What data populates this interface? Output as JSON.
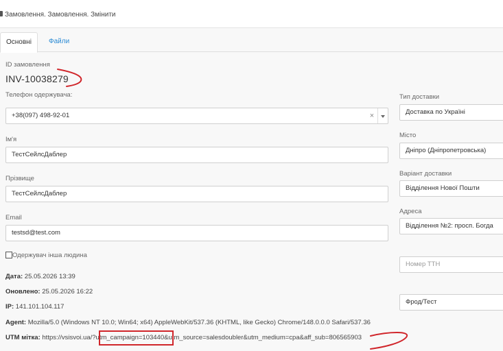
{
  "header": {
    "title": "Замовлення. Замовлення. Змінити"
  },
  "tabs": [
    {
      "label": "Основні"
    },
    {
      "label": "Файли"
    }
  ],
  "order": {
    "id_label": "ID замовлення",
    "id_value": "INV-10038279"
  },
  "form": {
    "phone": {
      "label": "Телефон одержувача:",
      "value": "+38(097) 498-92-01",
      "clear": "×"
    },
    "first_name": {
      "label": "Ім'я",
      "value": "ТестСейлсДаблер"
    },
    "last_name": {
      "label": "Прізвище",
      "value": "ТестСейлсДаблер"
    },
    "email": {
      "label": "Email",
      "value": "testsd@test.com"
    },
    "other_recipient": {
      "label": "Одержувач інша людина",
      "checked": false
    }
  },
  "delivery": {
    "type": {
      "label": "Тип доставки",
      "value": "Доставка по Україні"
    },
    "city": {
      "label": "Місто",
      "value": "Дніпро (Дніпропетровська)"
    },
    "variant": {
      "label": "Варіант доставки",
      "value": "Відділення Нової Пошти"
    },
    "address": {
      "label": "Адреса",
      "value": "Відділення №2: просп. Богда"
    },
    "ttn": {
      "placeholder": "Номер ТТН"
    },
    "status": {
      "value": "Фрод/Тест"
    }
  },
  "meta": {
    "date": {
      "label": "Дата:",
      "value": "25.05.2026 13:39"
    },
    "updated": {
      "label": "Оновлено:",
      "value": "25.05.2026 16:22"
    },
    "ip": {
      "label": "IP:",
      "value": "141.101.104.117"
    },
    "agent": {
      "label": "Agent:",
      "value": "Mozilla/5.0 (Windows NT 10.0; Win64; x64) AppleWebKit/537.36 (KHTML, like Gecko) Chrome/148.0.0.0 Safari/537.36"
    },
    "utm": {
      "label": "UTM мітка:",
      "prefix": "https://vsisvoi.ua/?",
      "highlight": "utm_campaign=103440",
      "suffix": "&utm_source=salesdoubler&utm_medium=cpa&aff_sub=806565903"
    }
  },
  "annotation_color": "#d0252a"
}
